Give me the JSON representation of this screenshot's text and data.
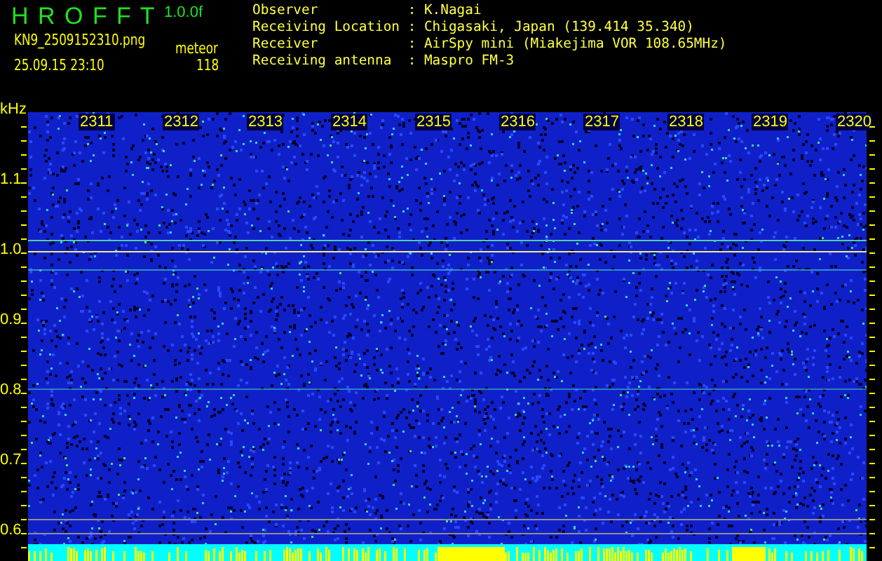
{
  "header": {
    "title": "H R O F F T",
    "version": "1.0.0f",
    "file_name": "KN9_2509152310.png",
    "timestamp": "25.09.15 23:10",
    "meteor_label": "meteor",
    "meteor_count": "118"
  },
  "info": [
    {
      "label": "Observer",
      "value": "K.Nagai"
    },
    {
      "label": "Receiving Location",
      "value": "Chigasaki, Japan (139.414 35.340)"
    },
    {
      "label": "Receiver",
      "value": "AirSpy mini (Miakejima VOR 108.65MHz)"
    },
    {
      "label": "Receiving antenna",
      "value": "Maspro FM-3"
    }
  ],
  "info_separator": ":",
  "plot": {
    "y_unit": "kHz",
    "y_labels": [
      "1.1",
      "1.0",
      "0.9",
      "0.8",
      "0.7",
      "0.6"
    ],
    "time_labels": [
      "2311",
      "2312",
      "2313",
      "2314",
      "2315",
      "2316",
      "2317",
      "2318",
      "2319",
      "2320"
    ]
  }
}
